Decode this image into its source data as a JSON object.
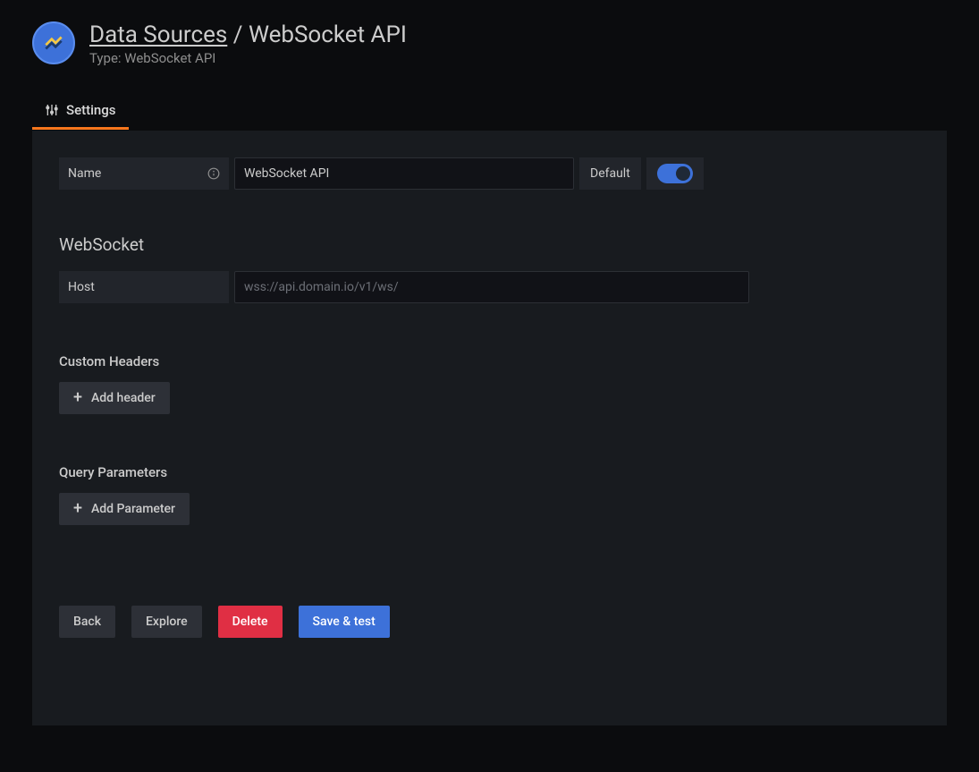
{
  "header": {
    "breadcrumb_parent": "Data Sources",
    "breadcrumb_current": "WebSocket API",
    "subtitle": "Type: WebSocket API"
  },
  "tabs": {
    "settings": "Settings"
  },
  "form": {
    "name_label": "Name",
    "name_value": "WebSocket API",
    "default_label": "Default"
  },
  "websocket": {
    "heading": "WebSocket",
    "host_label": "Host",
    "host_placeholder": "wss://api.domain.io/v1/ws/",
    "host_value": ""
  },
  "custom_headers": {
    "heading": "Custom Headers",
    "add_button": "Add header"
  },
  "query_parameters": {
    "heading": "Query Parameters",
    "add_button": "Add Parameter"
  },
  "actions": {
    "back": "Back",
    "explore": "Explore",
    "delete": "Delete",
    "save_test": "Save & test"
  }
}
